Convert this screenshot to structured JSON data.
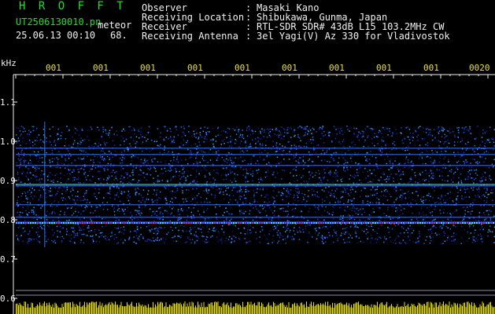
{
  "header": {
    "title": "H R O F F T",
    "filename": "UT2506130010.pn",
    "meteor_label": "meteor",
    "datetime": "25.06.13 00:10",
    "count": "68."
  },
  "station_info": [
    {
      "label": "Observer",
      "sep": ":",
      "value": "Masaki Kano"
    },
    {
      "label": "Receiving Location",
      "sep": ":",
      "value": "Shibukawa, Gunma, Japan"
    },
    {
      "label": "Receiver",
      "sep": ":",
      "value": "RTL-SDR SDR# 43dB L15 103.2MHz CW"
    },
    {
      "label": "Receiving Antenna",
      "sep": ":",
      "value": "3el Yagi(V) Az 330 for Vladivostok"
    }
  ],
  "axes": {
    "y_unit": "kHz",
    "y_ticks": [
      "1.1",
      "1.0",
      "0.9",
      "0.8",
      "0.7",
      "0.6"
    ],
    "x_ticks": [
      "001",
      "001",
      "001",
      "001",
      "001",
      "001",
      "001",
      "001",
      "001",
      "0020"
    ]
  },
  "colors": {
    "background": "#000000",
    "title_green": "#22dd22",
    "axis_yellow": "#e8e030",
    "text_white": "#f0f0f0",
    "spectrum_blue": "#1830c0",
    "meteor_band_red": "#ff3020",
    "noise_floor_yellow": "#e8e000"
  }
}
